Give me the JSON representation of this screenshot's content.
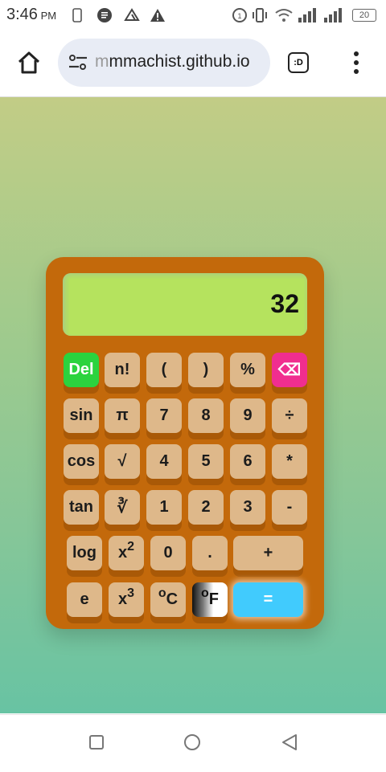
{
  "status_bar": {
    "time": "3:46",
    "ampm": "PM",
    "battery": "20"
  },
  "browser": {
    "url_faded": "m",
    "url": "mmachist.github.io",
    "tab_icon_label": ":D"
  },
  "calculator": {
    "display": "32",
    "keys": {
      "del": "Del",
      "fact": "n!",
      "lparen": "(",
      "rparen": ")",
      "percent": "%",
      "backspace": "⌫",
      "sin": "sin",
      "pi": "π",
      "seven": "7",
      "eight": "8",
      "nine": "9",
      "divide": "÷",
      "cos": "cos",
      "sqrt": "√",
      "four": "4",
      "five": "5",
      "six": "6",
      "multiply": "*",
      "tan": "tan",
      "cbrt": "∛",
      "one": "1",
      "two": "2",
      "three": "3",
      "minus": "-",
      "log": "log",
      "square_base": "x",
      "square_exp": "2",
      "zero": "0",
      "dot": ".",
      "plus": "+",
      "e": "e",
      "cube_base": "x",
      "cube_exp": "3",
      "celsius_deg": "o",
      "celsius_unit": "C",
      "fahrenheit_deg": "o",
      "fahrenheit_unit": "F",
      "equals": "="
    }
  },
  "colors": {
    "body": "#c3690b",
    "key": "#deb88a",
    "del": "#2bd33e",
    "backspace": "#f02e8f",
    "equals": "#41cbfd",
    "lcd": "#b5e35e"
  }
}
